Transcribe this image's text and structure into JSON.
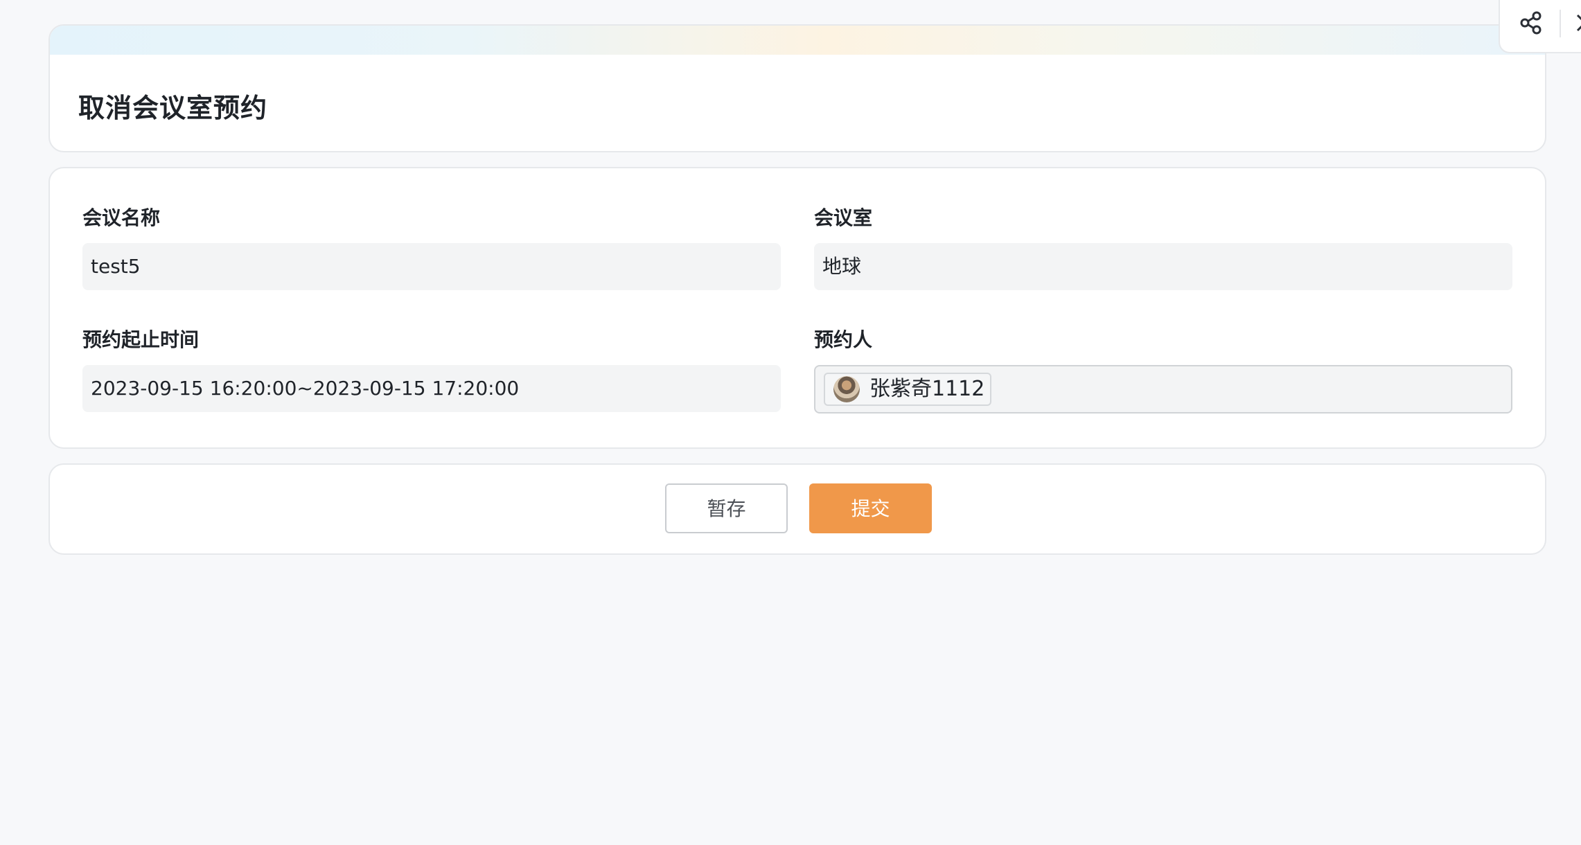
{
  "page": {
    "title": "取消会议室预约"
  },
  "form": {
    "meeting_name": {
      "label": "会议名称",
      "value": "test5"
    },
    "meeting_room": {
      "label": "会议室",
      "value": "地球"
    },
    "time_range": {
      "label": "预约起止时间",
      "value": "2023-09-15 16:20:00~2023-09-15 17:20:00"
    },
    "booker": {
      "label": "预约人",
      "value": "张紫奇1112"
    }
  },
  "actions": {
    "save_label": "暂存",
    "submit_label": "提交"
  },
  "toolbar": {
    "share_icon": "share-icon",
    "close_icon": "close-icon"
  },
  "colors": {
    "accent": "#f0984a",
    "background": "#f7f8fa",
    "field_bg": "#f3f4f5"
  }
}
